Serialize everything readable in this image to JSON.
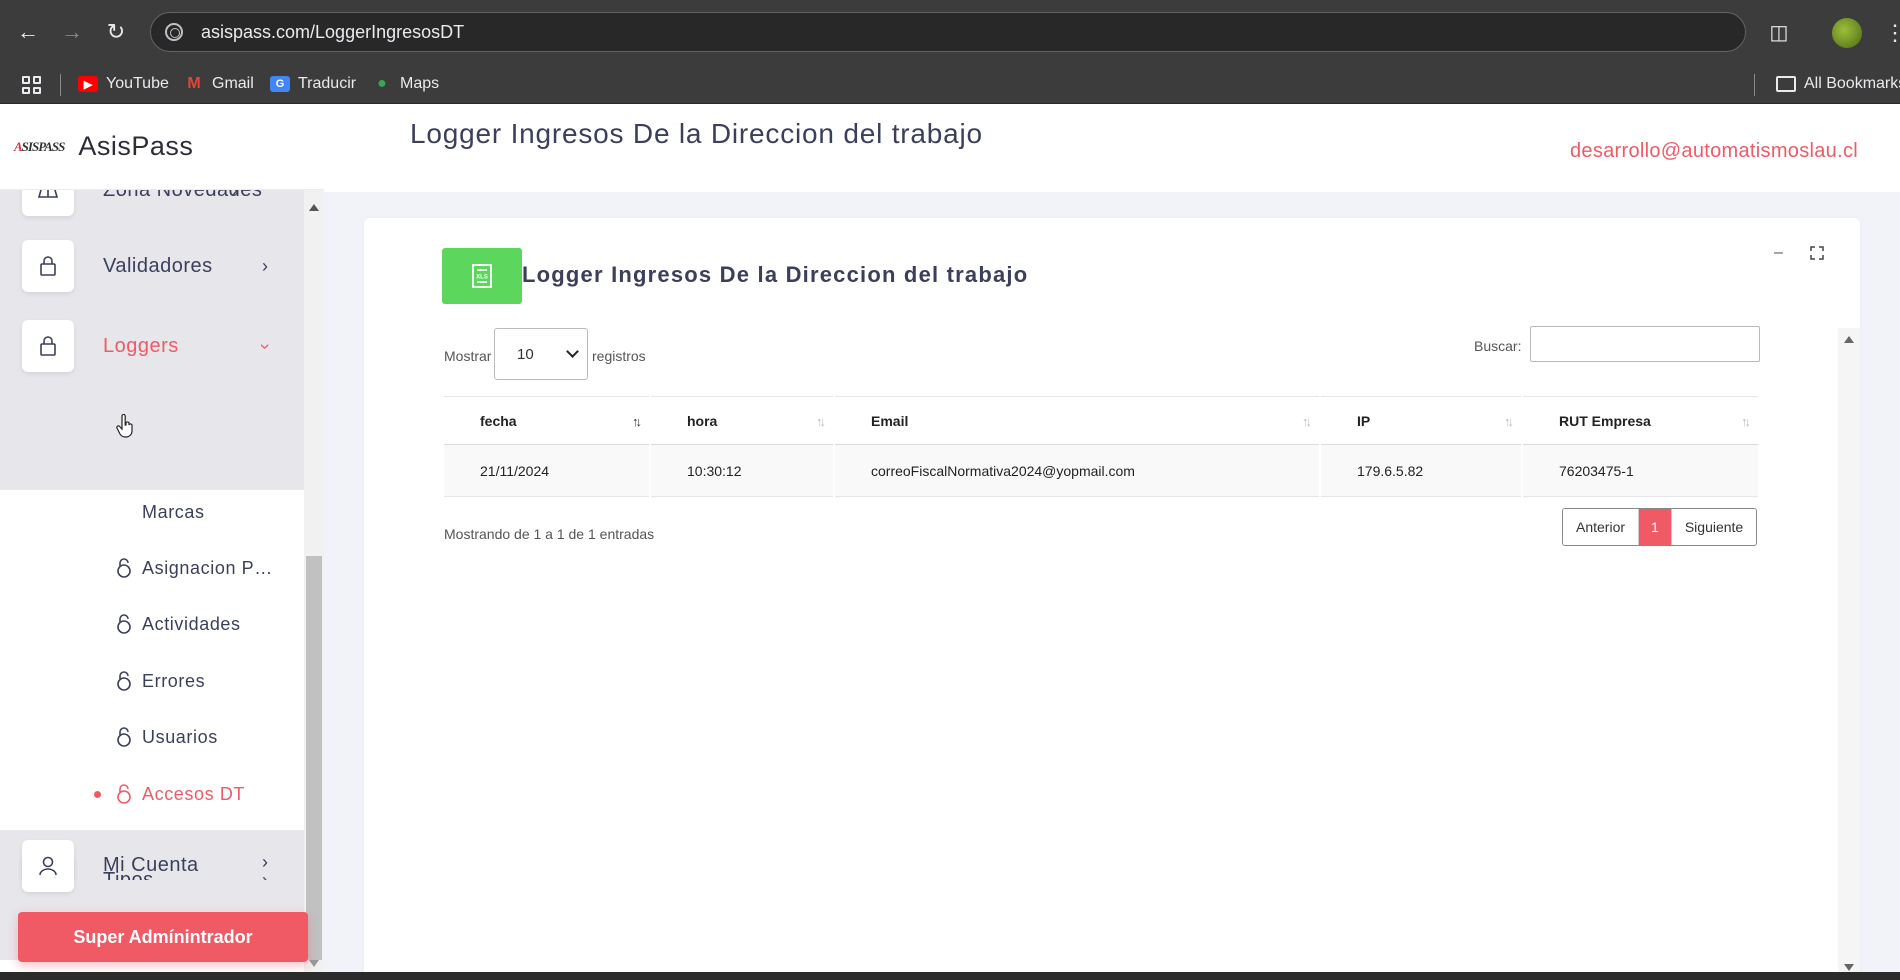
{
  "browser": {
    "url": "asispass.com/LoggerIngresosDT",
    "bookmarks": [
      {
        "label": "YouTube",
        "icon": "youtube-icon",
        "color": "#ff0000"
      },
      {
        "label": "Gmail",
        "icon": "gmail-icon",
        "color": "#ea4335"
      },
      {
        "label": "Traducir",
        "icon": "translate-icon",
        "color": "#4285f4"
      },
      {
        "label": "Maps",
        "icon": "maps-icon",
        "color": "#34a853"
      }
    ],
    "all_bookmarks": "All Bookmarks"
  },
  "brand": {
    "logo_text": "ASISPASS",
    "name": "AsisPass"
  },
  "sidebar": {
    "menu": [
      {
        "label": "Zona Novedades",
        "icon": "map-icon"
      },
      {
        "label": "Validadores",
        "icon": "lock-icon"
      },
      {
        "label": "Loggers",
        "icon": "lock-icon",
        "active": true
      },
      {
        "label": "Tipos",
        "icon": "sitemap-icon"
      },
      {
        "label": "Mi Cuenta",
        "icon": "user-icon"
      }
    ],
    "submenu": [
      {
        "label": "Marcas"
      },
      {
        "label": "Asignacion Permisos"
      },
      {
        "label": "Actividades"
      },
      {
        "label": "Errores"
      },
      {
        "label": "Usuarios"
      },
      {
        "label": "Accesos DT",
        "current": true
      }
    ],
    "super_admin_button": "Super Admínintrador"
  },
  "header": {
    "title": "Logger Ingresos De la Direccion del trabajo",
    "email": "desarrollo@automatismoslau.cl"
  },
  "card": {
    "title": "Logger Ingresos De la Direccion del trabajo",
    "export_icon": "excel-export-icon",
    "show_label": "Mostrar",
    "page_length": "10",
    "records_label": "registros",
    "search_label": "Buscar:",
    "search_value": "",
    "columns": [
      "fecha",
      "hora",
      "Email",
      "IP",
      "RUT Empresa"
    ],
    "rows": [
      [
        "21/11/2024",
        "10:30:12",
        "correoFiscalNormativa2024@yopmail.com",
        "179.6.5.82",
        "76203475-1"
      ]
    ],
    "info": "Mostrando de 1 a 1 de 1 entradas",
    "pagination": {
      "prev": "Anterior",
      "current": "1",
      "next": "Siguiente"
    }
  },
  "colors": {
    "accent": "#f05a64",
    "export_green": "#5cd65c",
    "text": "#3b3f5c"
  }
}
